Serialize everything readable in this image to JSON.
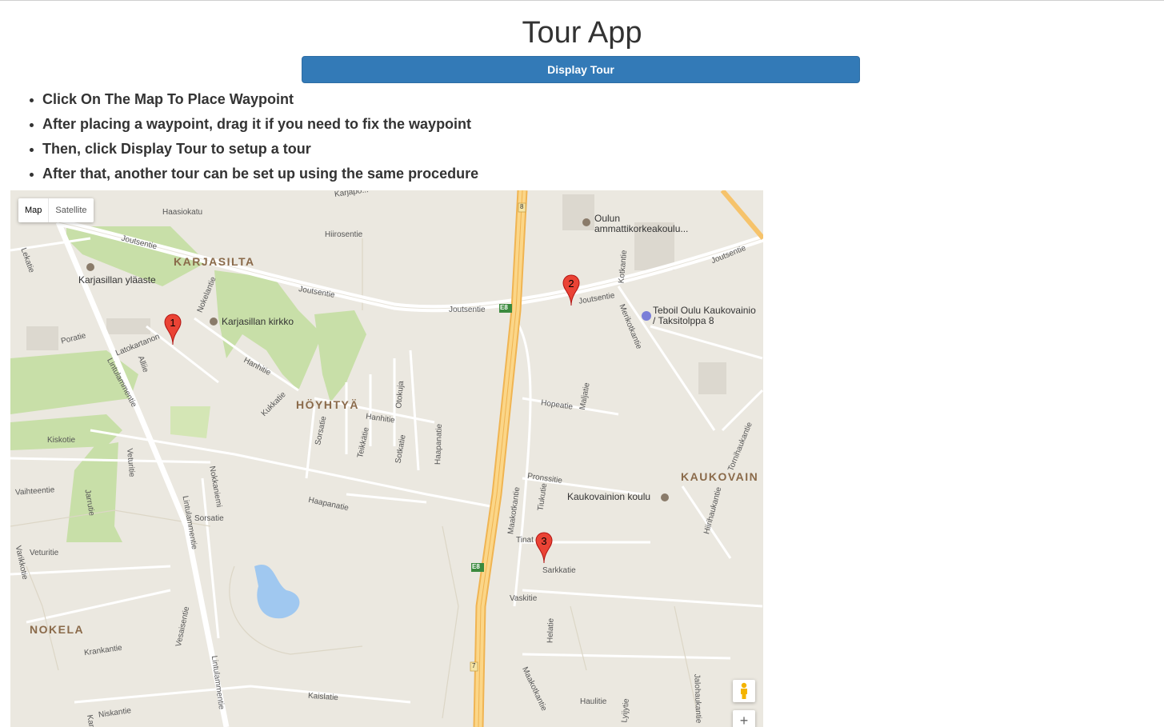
{
  "app": {
    "title": "Tour App",
    "display_button": "Display Tour"
  },
  "instructions": [
    "Click On The Map To Place Waypoint",
    "After placing a waypoint, drag it if you need to fix the waypoint",
    "Then, click Display Tour to setup a tour",
    "After that, another tour can be set up using the same procedure"
  ],
  "map": {
    "map_type": {
      "map": "Map",
      "satellite": "Satellite",
      "selected": "Map"
    },
    "zoom_in": "+",
    "markers": [
      "1",
      "2",
      "3"
    ],
    "districts": {
      "karjasilta": "KARJASILTA",
      "hoyhtya": "HÖYHTYÄ",
      "kaukovain": "KAUKOVAIN",
      "nokela": "NOKELA"
    },
    "pois": {
      "oulun": "Oulun",
      "ammatti": "ammattikorkeakoulu...",
      "ylaaste": "Karjasillan yläaste",
      "kirkko": "Karjasillan kirkko",
      "teboil1": "Teboil Oulu Kaukovainio",
      "teboil2": "/ Taksitolppa 8",
      "koulu": "Kaukovainion koulu"
    },
    "streets": {
      "karjap": "Karjapo...",
      "haasiokatu": "Haasiokatu",
      "hiirosentie": "Hiirosentie",
      "joutsentie1": "Joutsentie",
      "joutsentie2": "Joutsentie",
      "joutsentie3": "Joutsentie",
      "joutsentie4": "Joutsentie",
      "joutsentie5": "Joutsentie",
      "lekatie": "Lekatie",
      "nokelantie": "Nokelantie",
      "poratie": "Poratie",
      "latokartanon": "Latokartanon",
      "alliie": "Alliie",
      "lintulammentie1": "Lintulammentie",
      "hanhitie1": "Hanhitie",
      "kukkatie": "Kukkatie",
      "kiskotie": "Kiskotie",
      "sorsatie1": "Sorsatie",
      "teikkatie": "Teikkätie",
      "hanhitie2": "Hanhitie",
      "otokuja": "Otokuja",
      "sotkatie": "Sotkatie",
      "haapanatie1": "Haapanatie",
      "veturitie1": "Veturitie",
      "vaihteentie": "Vaihteentie",
      "jarrutie": "Jarrutie",
      "nokkaniemi": "Nokkaniemi",
      "lintulammentie2": "Lintulammentie",
      "sorsatie2": "Sorsatie",
      "haapanatie2": "Haapanatie",
      "veturitie2": "Veturitie",
      "varikkotie": "Varikkotie",
      "vesaisentie": "Vesaisentie",
      "krankantie": "Krankantie",
      "lintulammentie3": "Lintulammentie",
      "kaislatie": "Kaislatie",
      "niskantie": "Niskantie",
      "kar": "Kar",
      "kotkantie": "Kotkantie",
      "merikotkantie": "Merikotkantie",
      "hopeatie": "Hopeatie",
      "maljatie": "Maljatie",
      "pronssitie": "Pronssitie",
      "maakotkantie1": "Maakotkantie",
      "tiukutie": "Tiukutie",
      "tinat": "Tinat",
      "sarkkatie": "Sarkkatie",
      "vaskitie": "Vaskitie",
      "helatie": "Helatie",
      "maakotkantie2": "Maakotkantie",
      "haulitie": "Haulitie",
      "lyijytie": "Lyijytie",
      "jalohaukantie": "Jalohaukantie",
      "hiirihaukantie": "Hiirihaukantie",
      "tornihaukantie": "Tornihaukantie",
      "e8a": "E8",
      "e8b": "E8",
      "r8": "8",
      "r7": "7"
    }
  },
  "colors": {
    "button": "#337ab7",
    "map_bg": "#ebe8e0",
    "park": "#c8dfa8",
    "water": "#a0c8f0",
    "highway": "#f6c36b",
    "marker": "#ea4335"
  }
}
